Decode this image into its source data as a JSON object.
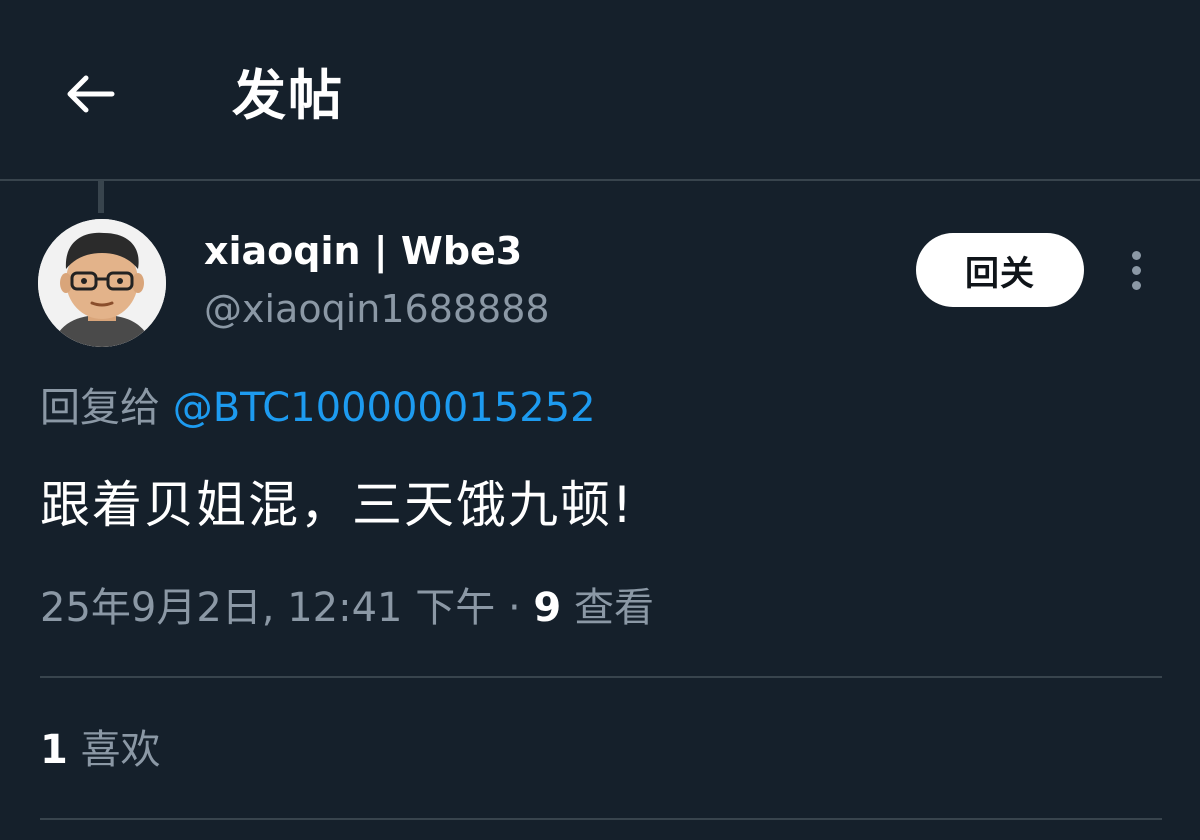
{
  "header": {
    "back_icon": "arrow-left-icon",
    "title": "发帖"
  },
  "author": {
    "avatar_icon": "cartoon-avatar",
    "display_name": "xiaoqin | Wbe3",
    "handle": "@xiaoqin1688888"
  },
  "follow_button": {
    "label": "回关"
  },
  "more_icon": "more-vertical-icon",
  "reply": {
    "prefix": "回复给",
    "mention": "@BTC100000015252"
  },
  "tweet": {
    "text": "跟着贝姐混，三天饿九顿!"
  },
  "meta": {
    "date": "25年9月2日,",
    "time": "12:41 下午",
    "separator": "·",
    "views_count": "9",
    "views_label": "查看"
  },
  "likes": {
    "count": "1",
    "label": "喜欢"
  },
  "colors": {
    "background": "#15202b",
    "divider": "#38444d",
    "secondary_text": "#8b98a5",
    "link": "#1d9bf0",
    "primary_text": "#ffffff"
  }
}
